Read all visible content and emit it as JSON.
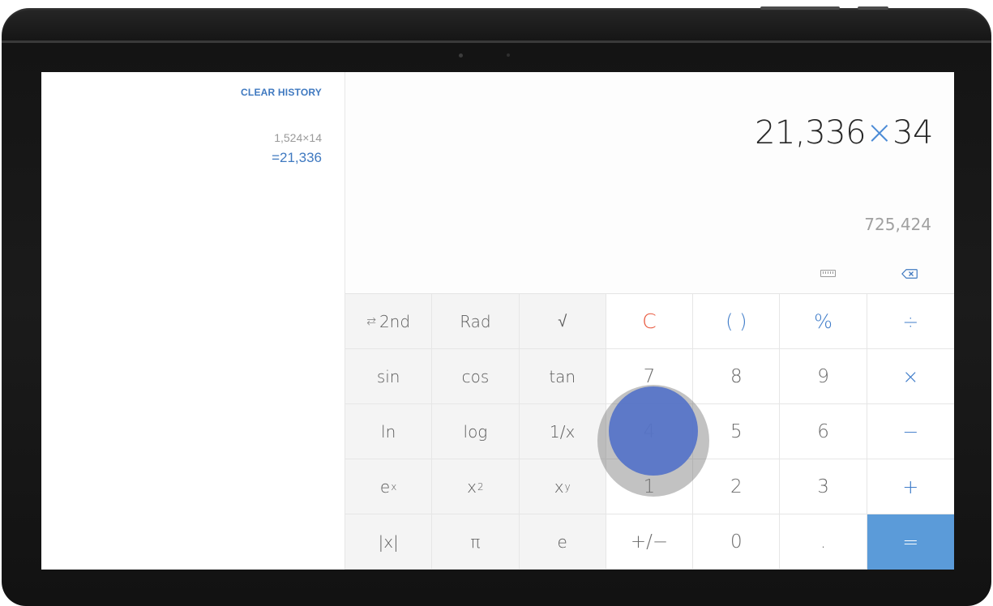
{
  "history": {
    "clear_label": "CLEAR HISTORY",
    "entries": [
      {
        "expression": "1,524×14",
        "result": "=21,336"
      }
    ]
  },
  "display": {
    "operand_a": "21,336",
    "operator": "×",
    "operand_b": "34",
    "preview": "725,424"
  },
  "icons": {
    "unit_converter": "ruler-icon",
    "backspace": "backspace-icon",
    "toggle_second": "swap-arrows-icon"
  },
  "keypad": {
    "second": "2nd",
    "second_icon_glyph": "⇆",
    "rad": "Rad",
    "sqrt": "√",
    "clear": "C",
    "parens": "( )",
    "percent": "%",
    "divide": "÷",
    "sin": "sin",
    "cos": "cos",
    "tan": "tan",
    "seven": "7",
    "eight": "8",
    "nine": "9",
    "multiply": "×",
    "ln": "ln",
    "log": "log",
    "reciprocal": "1/x",
    "four": "4",
    "five": "5",
    "six": "6",
    "minus": "−",
    "exp_base": "e",
    "exp_sup": "x",
    "square_base": "x",
    "square_sup": "2",
    "power_base": "x",
    "power_sup": "y",
    "one": "1",
    "two": "2",
    "three": "3",
    "plus": "+",
    "abs": "|x|",
    "pi": "π",
    "e": "e",
    "negate": "+/−",
    "zero": "0",
    "decimal": ".",
    "equals": "="
  },
  "colors": {
    "accent": "#3f79c0",
    "clear": "#e8553a",
    "equals_bg": "#5b9bd9"
  }
}
